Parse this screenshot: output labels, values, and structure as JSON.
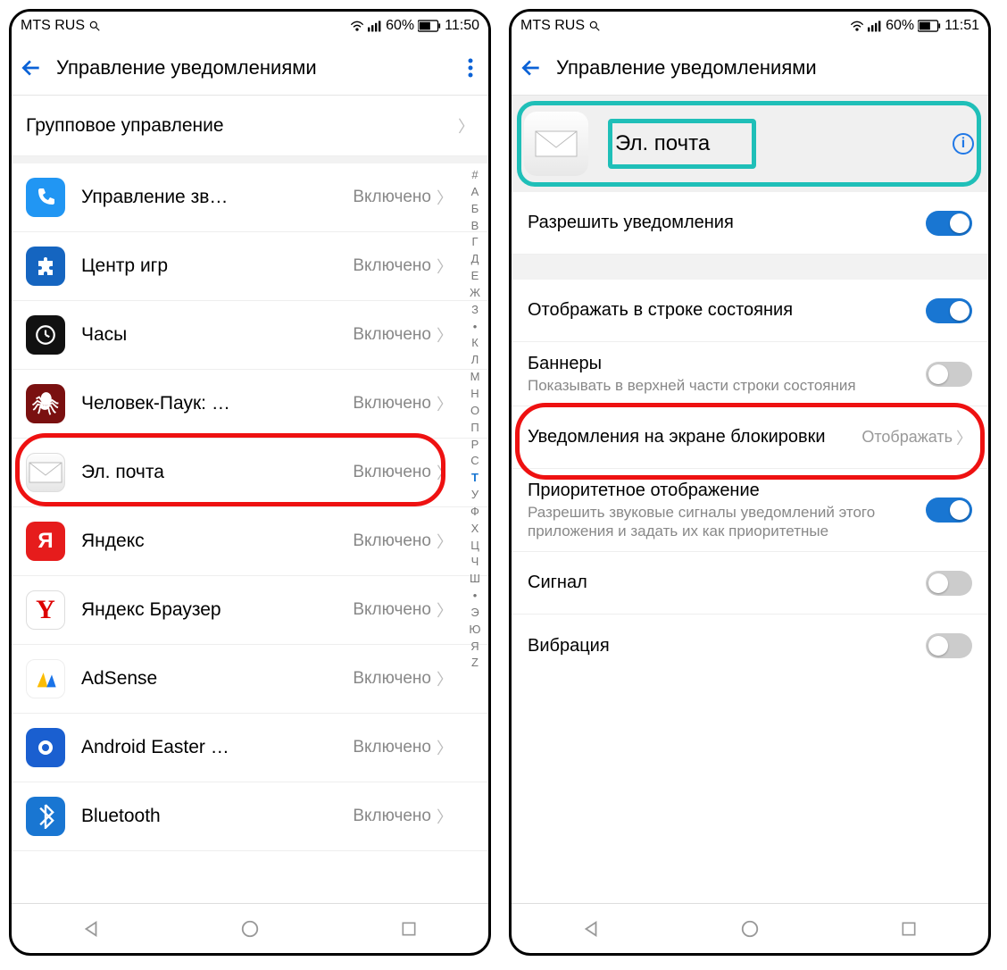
{
  "left": {
    "statusbar": {
      "carrier": "MTS RUS",
      "battery": "60%",
      "time": "11:50"
    },
    "header": {
      "title": "Управление уведомлениями"
    },
    "group_row": "Групповое управление",
    "status_text": "Включено",
    "apps": [
      {
        "name": "Управление зв…",
        "icon": "phone"
      },
      {
        "name": "Центр игр",
        "icon": "puzzle"
      },
      {
        "name": "Часы",
        "icon": "clock"
      },
      {
        "name": "Человек-Паук: …",
        "icon": "spider"
      },
      {
        "name": "Эл. почта",
        "icon": "mail",
        "highlighted": true
      },
      {
        "name": "Яндекс",
        "icon": "yandex"
      },
      {
        "name": "Яндекс Браузер",
        "icon": "ybrowser"
      },
      {
        "name": "AdSense",
        "icon": "adsense"
      },
      {
        "name": "Android Easter …",
        "icon": "egg"
      },
      {
        "name": "Bluetooth",
        "icon": "bt"
      }
    ],
    "index_letters": [
      "#",
      "А",
      "Б",
      "В",
      "Г",
      "Д",
      "Е",
      "Ж",
      "З",
      "•",
      "К",
      "Л",
      "М",
      "Н",
      "О",
      "П",
      "Р",
      "С",
      "Т",
      "У",
      "Ф",
      "Х",
      "Ц",
      "Ч",
      "Ш",
      "•",
      "Э",
      "Ю",
      "Я",
      "Z"
    ],
    "active_index": "Т"
  },
  "right": {
    "statusbar": {
      "carrier": "MTS RUS",
      "battery": "60%",
      "time": "11:51"
    },
    "header": {
      "title": "Управление уведомлениями"
    },
    "app": {
      "name": "Эл. почта"
    },
    "settings": {
      "allow": {
        "title": "Разрешить уведомления",
        "on": true
      },
      "statusbar_show": {
        "title": "Отображать в строке состояния",
        "on": true
      },
      "banners": {
        "title": "Баннеры",
        "sub": "Показывать в верхней части строки состояния",
        "on": false
      },
      "lockscreen": {
        "title": "Уведомления на экране блокировки",
        "value": "Отображать",
        "highlighted": true
      },
      "priority": {
        "title": "Приоритетное отображение",
        "sub": "Разрешить звуковые сигналы уведомлений этого приложения и задать их как приоритетные",
        "on": true
      },
      "sound": {
        "title": "Сигнал",
        "on": false
      },
      "vibration": {
        "title": "Вибрация",
        "on": false
      }
    }
  }
}
